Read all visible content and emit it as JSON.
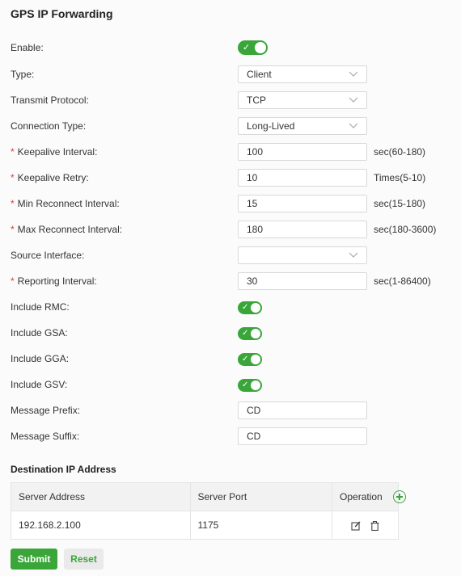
{
  "page_title": "GPS IP Forwarding",
  "form": {
    "enable": {
      "label": "Enable:",
      "value": true
    },
    "type": {
      "label": "Type:",
      "value": "Client"
    },
    "transmit_protocol": {
      "label": "Transmit Protocol:",
      "value": "TCP"
    },
    "connection_type": {
      "label": "Connection Type:",
      "value": "Long-Lived"
    },
    "keepalive_interval": {
      "label": "Keepalive Interval:",
      "value": "100",
      "suffix": "sec(60-180)",
      "required": true
    },
    "keepalive_retry": {
      "label": "Keepalive Retry:",
      "value": "10",
      "suffix": "Times(5-10)",
      "required": true
    },
    "min_reconnect_interval": {
      "label": "Min Reconnect Interval:",
      "value": "15",
      "suffix": "sec(15-180)",
      "required": true
    },
    "max_reconnect_interval": {
      "label": "Max Reconnect Interval:",
      "value": "180",
      "suffix": "sec(180-3600)",
      "required": true
    },
    "source_interface": {
      "label": "Source Interface:",
      "value": ""
    },
    "reporting_interval": {
      "label": "Reporting Interval:",
      "value": "30",
      "suffix": "sec(1-86400)",
      "required": true
    },
    "include_rmc": {
      "label": "Include RMC:",
      "value": true
    },
    "include_gsa": {
      "label": "Include GSA:",
      "value": true
    },
    "include_gga": {
      "label": "Include GGA:",
      "value": true
    },
    "include_gsv": {
      "label": "Include GSV:",
      "value": true
    },
    "message_prefix": {
      "label": "Message Prefix:",
      "value": "CD"
    },
    "message_suffix": {
      "label": "Message Suffix:",
      "value": "CD"
    }
  },
  "destination": {
    "title": "Destination IP Address",
    "columns": [
      "Server Address",
      "Server Port",
      "Operation"
    ],
    "rows": [
      {
        "server_address": "192.168.2.100",
        "server_port": "1175"
      }
    ]
  },
  "buttons": {
    "submit": "Submit",
    "reset": "Reset"
  },
  "colors": {
    "accent": "#3aa63a",
    "required": "#e0393e"
  }
}
